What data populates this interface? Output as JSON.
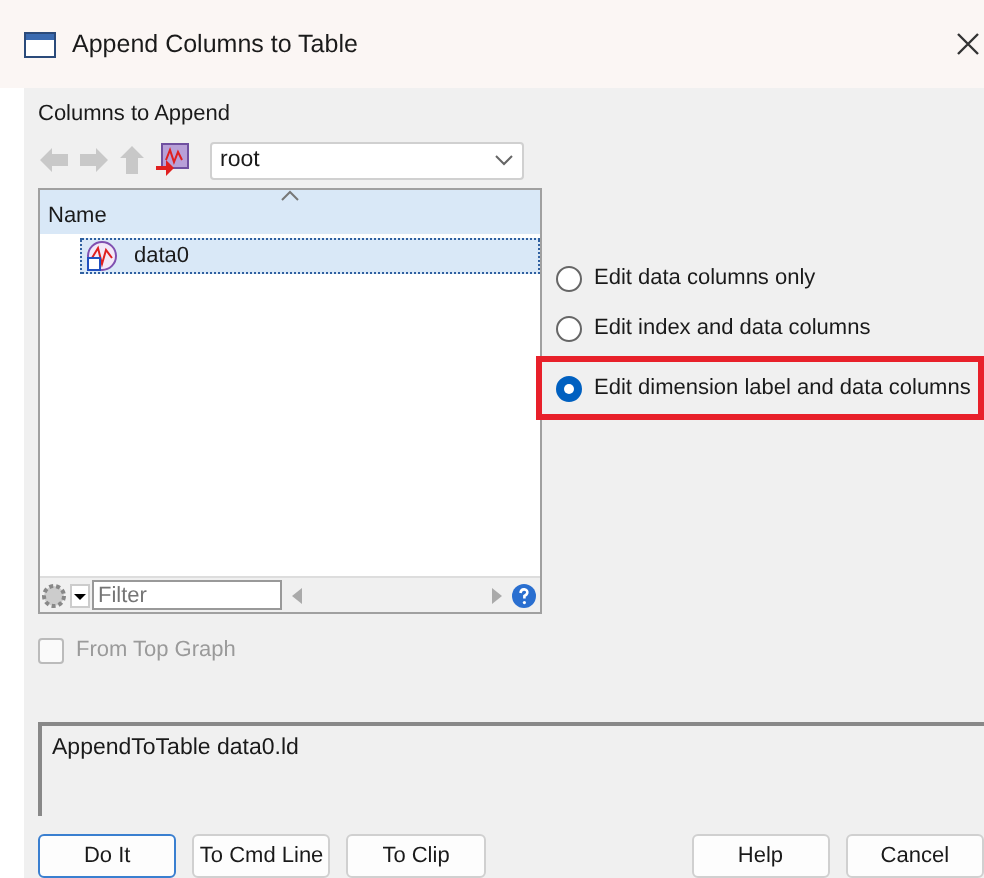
{
  "window": {
    "title": "Append Columns to Table"
  },
  "columns_label": "Columns to Append",
  "folder_combo": {
    "value": "root"
  },
  "list": {
    "column_header": "Name",
    "items": [
      {
        "name": "data0",
        "selected": true
      }
    ]
  },
  "filter": {
    "placeholder": "Filter"
  },
  "from_top_graph": {
    "label": "From Top Graph",
    "checked": false,
    "disabled": true
  },
  "options": [
    {
      "label": "Edit data columns only",
      "selected": false,
      "highlighted": false
    },
    {
      "label": "Edit index and data columns",
      "selected": false,
      "highlighted": false
    },
    {
      "label": "Edit dimension label and data columns",
      "selected": true,
      "highlighted": true
    }
  ],
  "command": "AppendToTable data0.ld",
  "buttons": [
    {
      "label": "Do It",
      "default": true
    },
    {
      "label": "To Cmd Line",
      "default": false
    },
    {
      "label": "To Clip",
      "default": false
    },
    {
      "label": "Help",
      "default": false
    },
    {
      "label": "Cancel",
      "default": false
    }
  ]
}
